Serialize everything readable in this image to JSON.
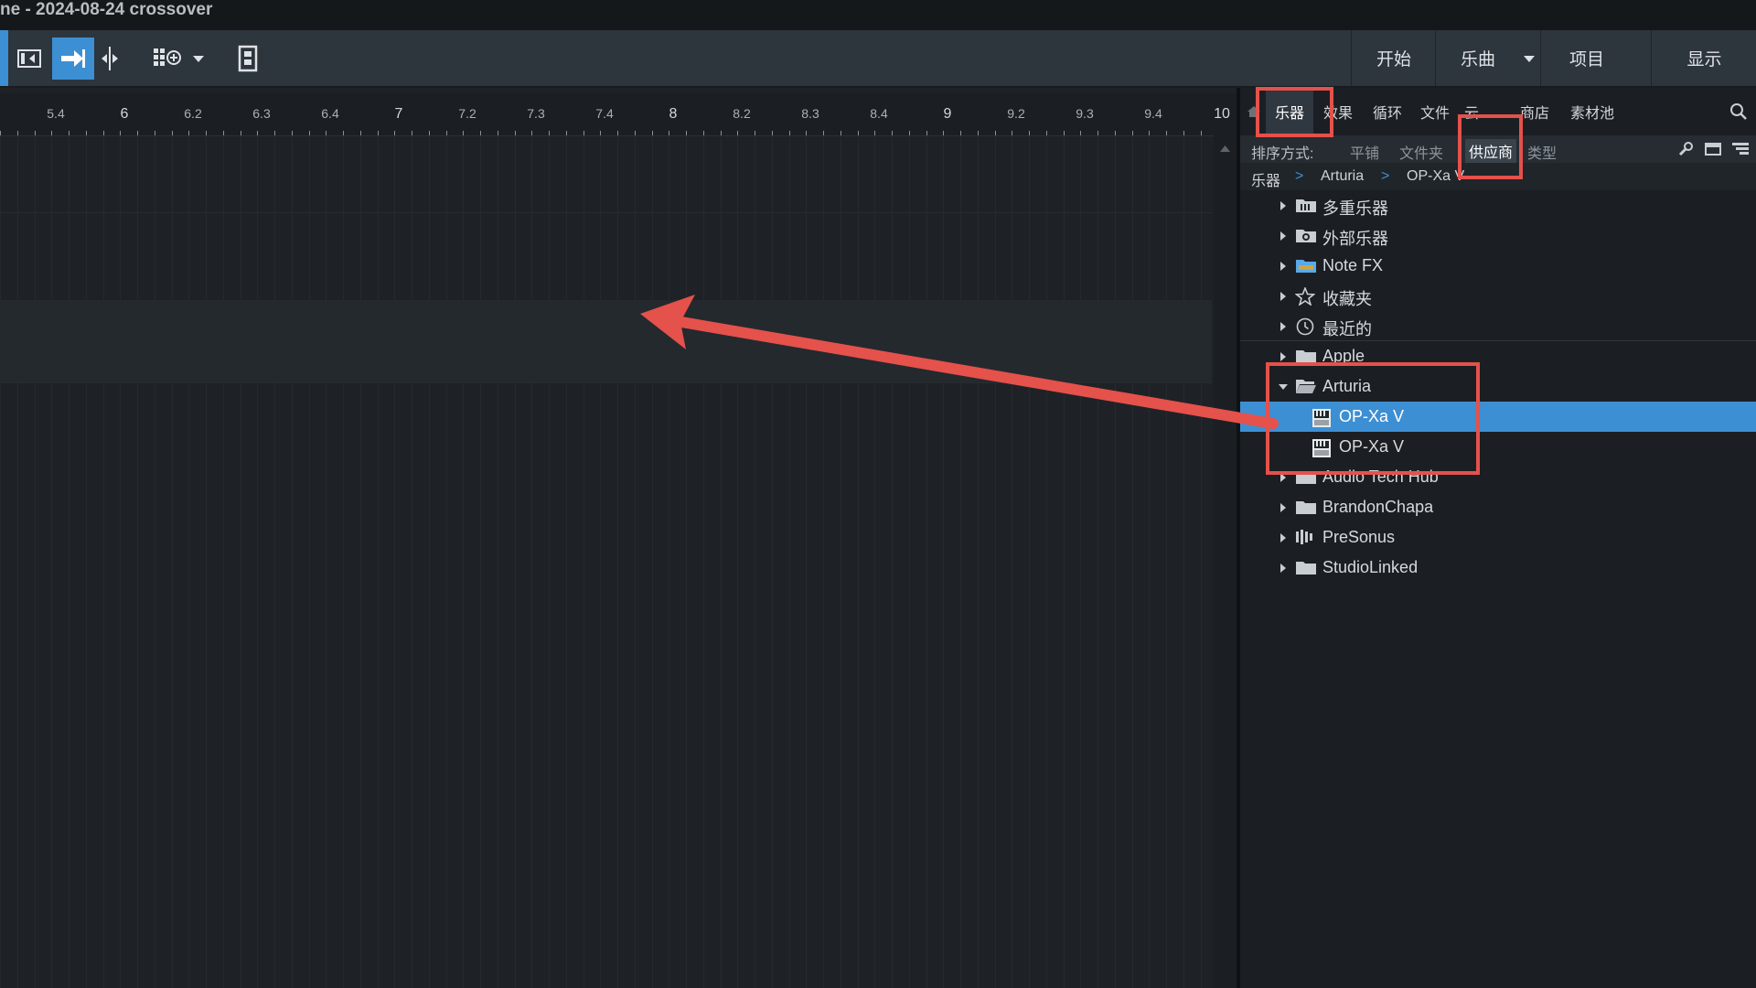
{
  "window": {
    "title": "ne - 2024-08-24 crossover"
  },
  "toolbar": {
    "tools": [
      {
        "icon": "track-list-icon"
      },
      {
        "icon": "arrow-right-icon"
      },
      {
        "icon": "split-cursor-icon"
      },
      {
        "icon": "grid-add-icon"
      },
      {
        "icon": "chevron-down-icon"
      },
      {
        "icon": "film-strip-icon"
      }
    ],
    "nav": [
      "开始",
      "乐曲",
      "项目",
      "显示"
    ]
  },
  "ruler": {
    "labels": [
      "5.4",
      "6",
      "6.2",
      "6.3",
      "6.4",
      "7",
      "7.2",
      "7.3",
      "7.4",
      "8",
      "8.2",
      "8.3",
      "8.4",
      "9",
      "9.2",
      "9.3",
      "9.4",
      "10"
    ]
  },
  "browser": {
    "tabs": [
      "乐器",
      "效果",
      "循环",
      "文件",
      "云",
      "商店",
      "素材池"
    ],
    "active_tab": "乐器",
    "sort_label": "排序方式:",
    "sort_options": [
      "平铺",
      "文件夹",
      "供应商",
      "类型"
    ],
    "active_sort": "供应商",
    "breadcrumb": [
      "乐器",
      "Arturia",
      "OP-Xa V"
    ],
    "tree": [
      {
        "label": "多重乐器",
        "icon": "multi-instrument-icon"
      },
      {
        "label": "外部乐器",
        "icon": "external-instrument-icon"
      },
      {
        "label": "Note FX",
        "icon": "note-fx-folder-icon"
      },
      {
        "label": "收藏夹",
        "icon": "star-icon"
      },
      {
        "label": "最近的",
        "icon": "clock-icon"
      },
      {
        "label": "Apple",
        "icon": "folder-icon"
      },
      {
        "label": "Arturia",
        "icon": "folder-open-icon"
      },
      {
        "label": "OP-Xa V",
        "icon": "plugin-vst-icon"
      },
      {
        "label": "OP-Xa V",
        "icon": "plugin-au-icon"
      },
      {
        "label": "Audio Tech Hub",
        "icon": "folder-icon"
      },
      {
        "label": "BrandonChapa",
        "icon": "folder-icon"
      },
      {
        "label": "PreSonus",
        "icon": "presonus-icon"
      },
      {
        "label": "StudioLinked",
        "icon": "folder-icon"
      }
    ]
  },
  "colors": {
    "accent": "#3d8fd3",
    "highlight": "#e5514b"
  }
}
